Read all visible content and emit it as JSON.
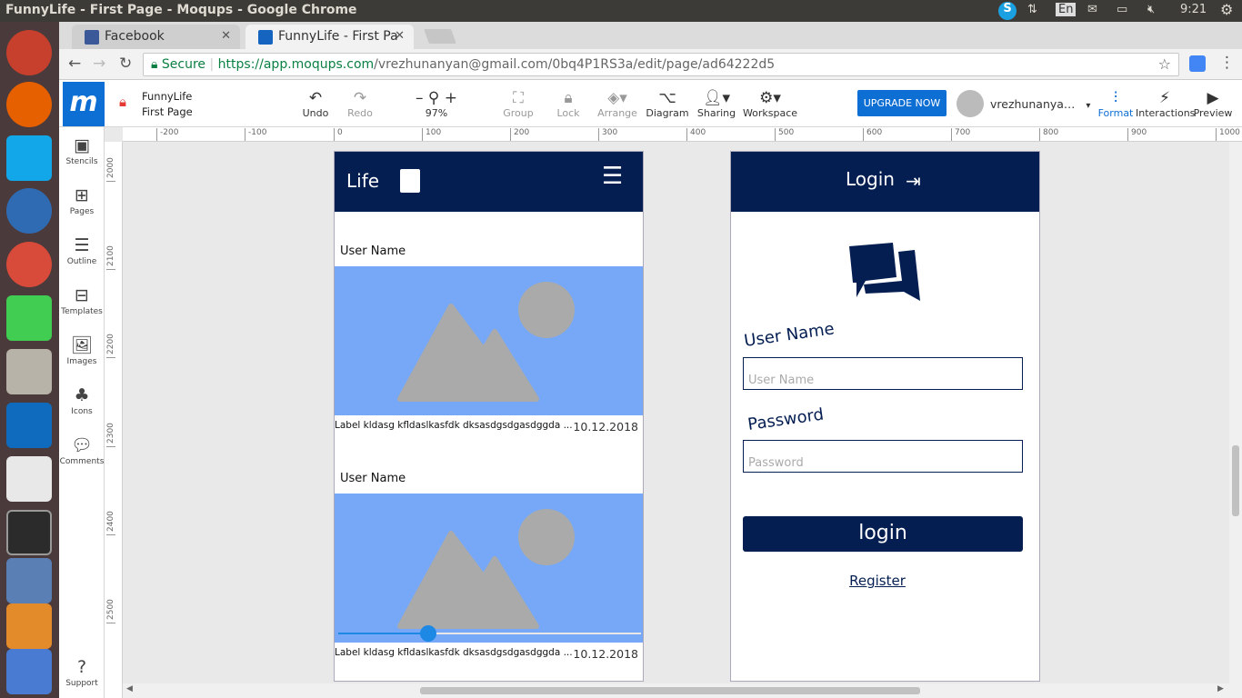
{
  "os": {
    "window_title": "FunnyLife - First Page - Moqups - Google Chrome",
    "keyboard_lang": "En",
    "clock": "9:21"
  },
  "browser": {
    "tabs": [
      {
        "label": "Facebook",
        "fav_color": "#3b5998",
        "active": false
      },
      {
        "label": "FunnyLife - First Pa",
        "fav_color": "#1565c0",
        "active": true
      }
    ],
    "secure_label": "Secure",
    "url_host": "https://app.moqups.com",
    "url_path": "/vrezhunanyan@gmail.com/0bq4P1RS3a/edit/page/ad64222d5"
  },
  "app": {
    "logo": "m",
    "project_name": "FunnyLife",
    "page_name": "First Page",
    "toolbar": {
      "undo": "Undo",
      "redo": "Redo",
      "zoom": "97%",
      "group": "Group",
      "lock": "Lock",
      "arrange": "Arrange",
      "diagram": "Diagram",
      "sharing": "Sharing",
      "workspace": "Workspace",
      "upgrade": "UPGRADE NOW",
      "user": "vrezhunanya…",
      "format": "Format",
      "interactions": "Interactions",
      "preview": "Preview"
    },
    "left_rail": [
      "Stencils",
      "Pages",
      "Outline",
      "Templates",
      "Images",
      "Icons",
      "Comments"
    ],
    "support": "Support",
    "ruler_h": [
      "-200",
      "-100",
      "0",
      "100",
      "200",
      "300",
      "400",
      "500",
      "600",
      "700",
      "800",
      "900",
      "1000"
    ],
    "ruler_v": [
      "2000",
      "2100",
      "2200",
      "2300",
      "2400",
      "2500"
    ],
    "accent": "#1a73e8"
  },
  "mock_feed": {
    "header_title": "Life",
    "header_color": "#041e52",
    "cards": [
      {
        "user": "User Name",
        "label": "Label kldasg kfldaslkasfdk dksasdgsdgasdggda ...",
        "date": "10.12.2018"
      },
      {
        "user": "User Name",
        "label": "Label kldasg kfldaslkasfdk dksasdgsdgasdggda ...",
        "date": "10.12.2018"
      }
    ],
    "image_bg": "#76a8f7"
  },
  "mock_login": {
    "header_title": "Login",
    "username_label": "User Name",
    "username_placeholder": "User Name",
    "password_label": "Password",
    "password_placeholder": "Password",
    "login_button": "login",
    "register_link": "Register"
  }
}
